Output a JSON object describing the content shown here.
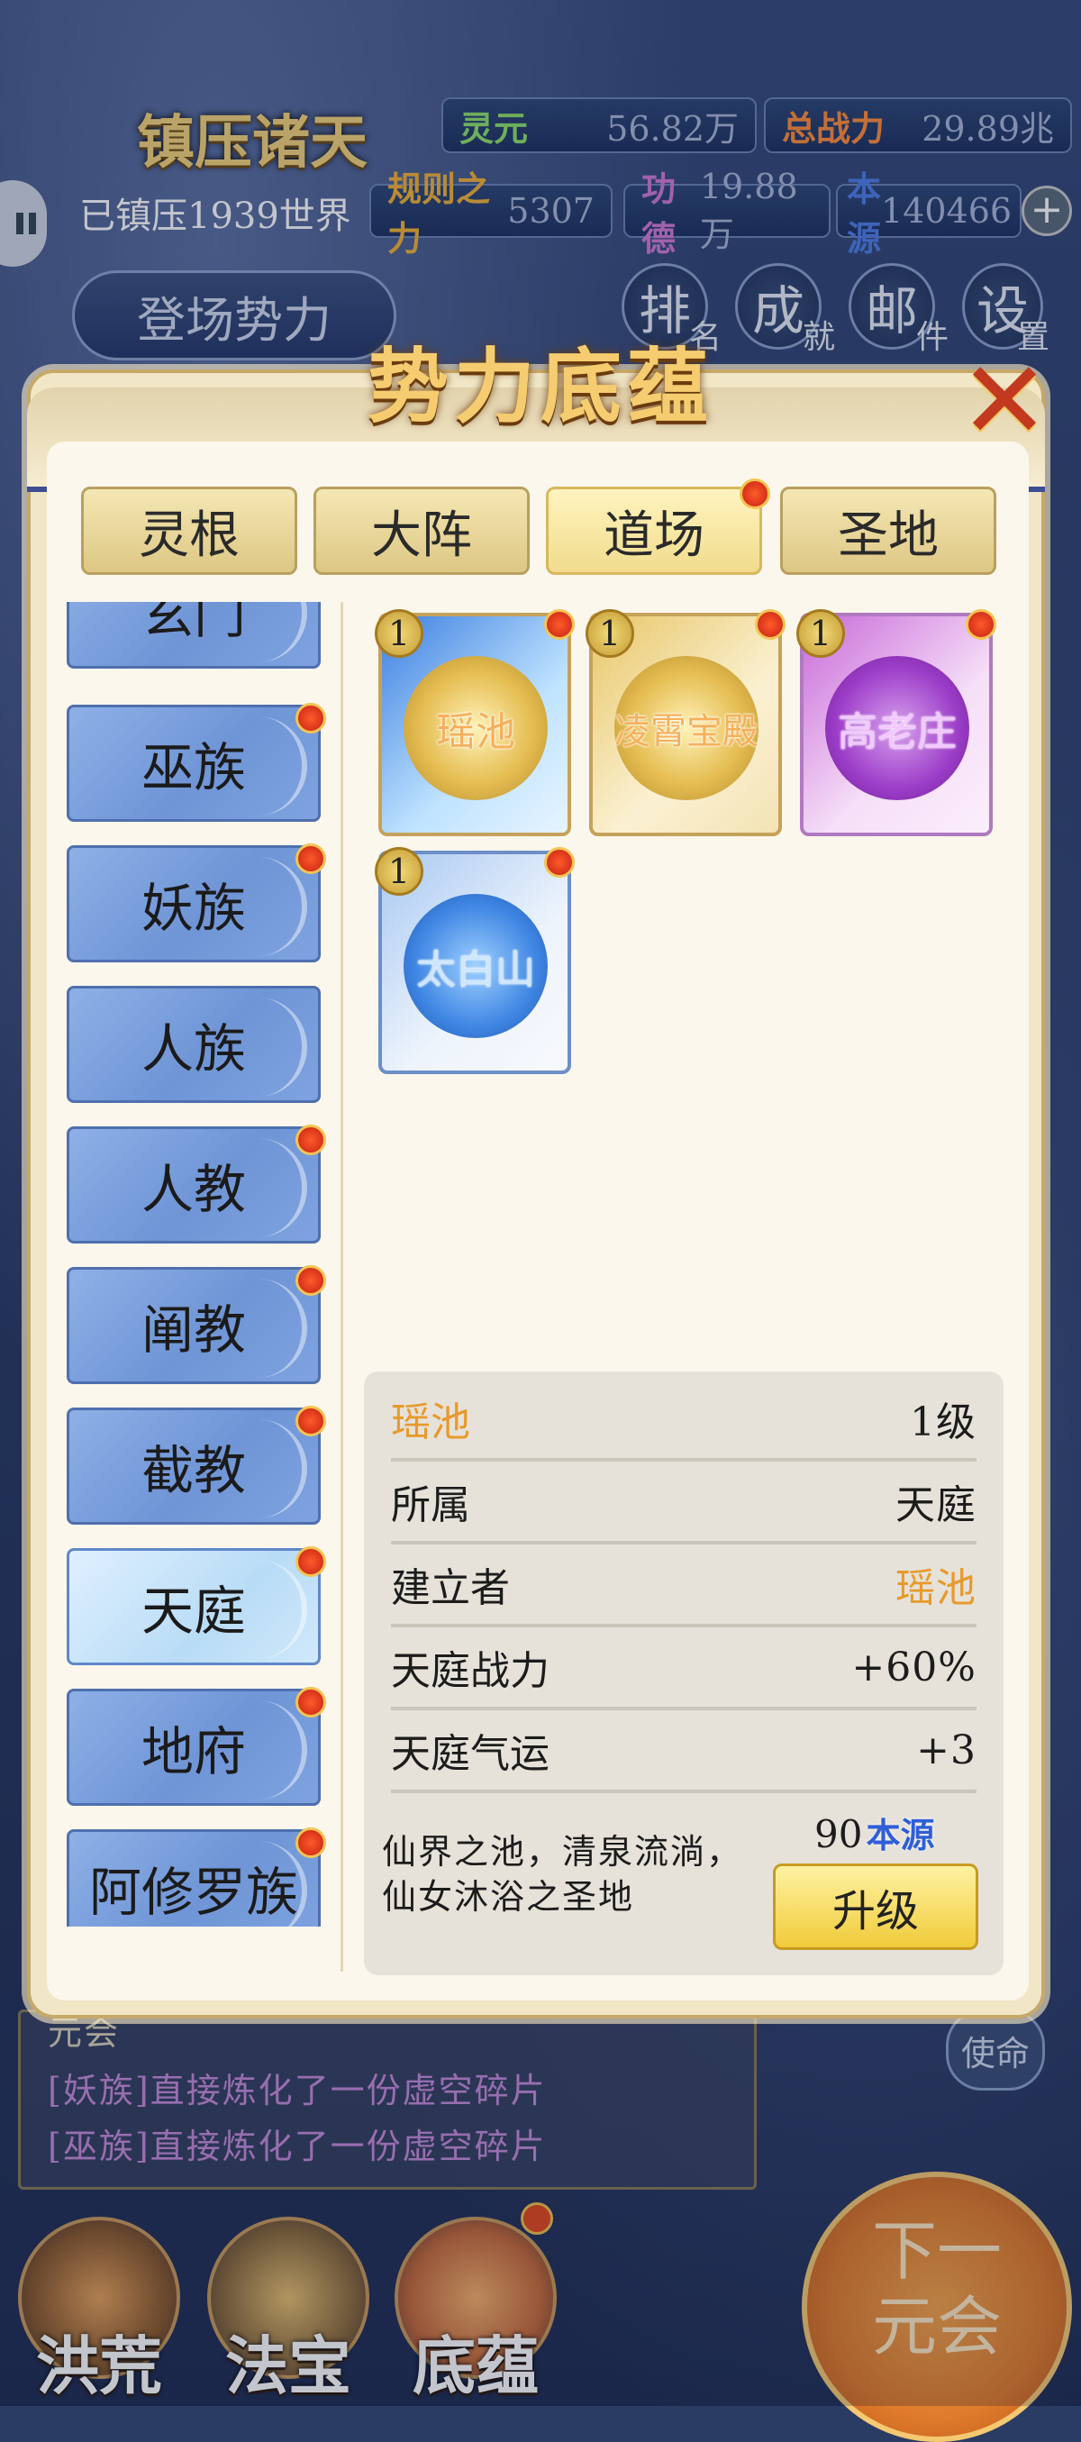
{
  "hud": {
    "title": "镇压诸天",
    "lingyuan_label": "灵元",
    "lingyuan_value": "56.82万",
    "total_power_label": "总战力",
    "total_power_value": "29.89兆",
    "suppressed": "已镇压1939世界",
    "rule_label": "规则之力",
    "rule_value": "5307",
    "merit_label": "功德",
    "merit_value": "19.88万",
    "source_label": "本源",
    "source_value": "140466",
    "plus_icon": "+",
    "enter_label": "登场势力",
    "menu": [
      {
        "main": "排",
        "sub": "名"
      },
      {
        "main": "成",
        "sub": "就"
      },
      {
        "main": "邮",
        "sub": "件"
      },
      {
        "main": "设",
        "sub": "置"
      }
    ]
  },
  "modal": {
    "title": "势力底蕴",
    "close_icon": "✕",
    "tabs": [
      {
        "label": "灵根",
        "dot": false
      },
      {
        "label": "大阵",
        "dot": false
      },
      {
        "label": "道场",
        "dot": true
      },
      {
        "label": "圣地",
        "dot": false
      }
    ],
    "active_tab": "道场",
    "factions": [
      {
        "label": "玄门",
        "dot": false
      },
      {
        "label": "巫族",
        "dot": true
      },
      {
        "label": "妖族",
        "dot": true
      },
      {
        "label": "人族",
        "dot": false
      },
      {
        "label": "人教",
        "dot": true
      },
      {
        "label": "阐教",
        "dot": true
      },
      {
        "label": "截教",
        "dot": true
      },
      {
        "label": "天庭",
        "dot": true
      },
      {
        "label": "地府",
        "dot": true
      },
      {
        "label": "阿修罗族",
        "dot": true
      }
    ],
    "selected_faction": "天庭",
    "buildings": [
      {
        "name": "瑶池",
        "level": "1",
        "style": "blue-gold",
        "dot": true
      },
      {
        "name": "凌霄宝殿",
        "level": "1",
        "style": "gold",
        "dot": true
      },
      {
        "name": "高老庄",
        "level": "1",
        "style": "purple",
        "dot": true
      },
      {
        "name": "太白山",
        "level": "1",
        "style": "blue",
        "dot": true
      }
    ],
    "info": {
      "name": "瑶池",
      "level": "1级",
      "rows": [
        {
          "label": "所属",
          "value": "天庭",
          "highlight": false
        },
        {
          "label": "建立者",
          "value": "瑶池",
          "highlight": true
        },
        {
          "label": "天庭战力",
          "value": "+60%",
          "highlight": false
        },
        {
          "label": "天庭气运",
          "value": "+3",
          "highlight": false
        }
      ],
      "description_line1": "仙界之池，清泉流淌，",
      "description_line2": "仙女沐浴之圣地",
      "cost_value": "90",
      "cost_unit": "本源",
      "upgrade_label": "升级"
    }
  },
  "log": {
    "title": "元会",
    "lines": [
      "[妖族]直接炼化了一份虚空碎片",
      "[巫族]直接炼化了一份虚空碎片"
    ]
  },
  "mission_label": "使命",
  "next_button": {
    "line1": "下一",
    "line2": "元会"
  },
  "bottom_nav": [
    {
      "label": "洪荒",
      "dot": false
    },
    {
      "label": "法宝",
      "dot": false
    },
    {
      "label": "底蕴",
      "dot": true
    }
  ],
  "colors": {
    "accent_orange": "#e79a2c",
    "notify_red": "#e2481e",
    "title_gold": "#f5cd70",
    "faction_blue": "#7fa3e0"
  }
}
